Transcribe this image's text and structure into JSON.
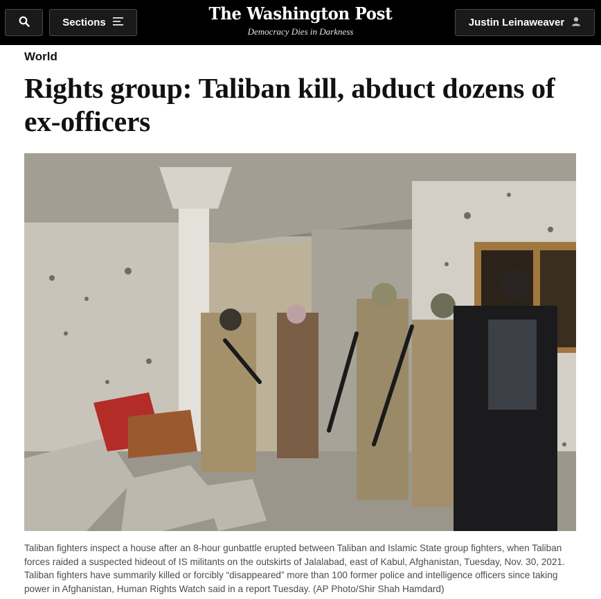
{
  "header": {
    "search_icon": "search-icon",
    "sections_label": "Sections",
    "sections_icon": "menu-lines-icon",
    "logo": "The Washington Post",
    "tagline": "Democracy Dies in Darkness",
    "user_name": "Justin Leinaweaver",
    "user_icon": "person-icon",
    "background_color": "#000000"
  },
  "article": {
    "section": "World",
    "headline": "Rights group: Taliban kill, abduct dozens of ex-officers",
    "caption": "Taliban fighters inspect a house after an 8-hour gunbattle erupted between Taliban and Islamic State group fighters, when Taliban forces raided a suspected hideout of IS militants on the outskirts of Jalalabad, east of Kabul, Afghanistan, Tuesday, Nov. 30, 2021. Taliban fighters have summarily killed or forcibly “disappeared” more than 100 former police and intelligence officers since taking power in Afghanistan, Human Rights Watch said in a report Tuesday. (AP Photo/Shir Shah Hamdard)"
  }
}
